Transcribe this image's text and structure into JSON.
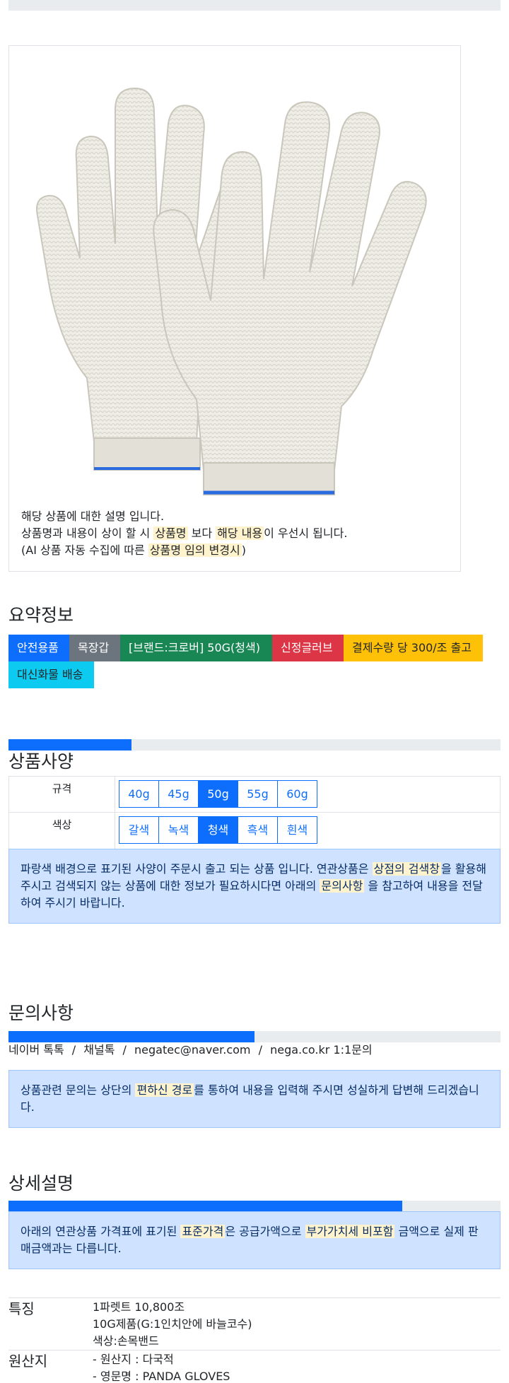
{
  "image": {
    "alt": "",
    "desc_line1": "해당 상품에 대한 설명 입니다.",
    "desc_line2_a": "상품명과 내용이 상이 할 시 ",
    "desc_line2_h1": "상품명",
    "desc_line2_b": " 보다 ",
    "desc_line2_h2": "해당 내용",
    "desc_line2_c": "이 우선시 됩니다.",
    "desc_line3_a": "(AI 상품 자동 수집에 따른 ",
    "desc_line3_h": "상품명 임의 변경시",
    "desc_line3_b": ")"
  },
  "summary": {
    "title": "요약정보",
    "badges": [
      {
        "label": "안전용품",
        "color": "#0d6efd"
      },
      {
        "label": "목장갑",
        "color": "#6c757d"
      },
      {
        "label": "[브랜드:크로버] 50G(청색)",
        "color": "#198754"
      },
      {
        "label": "신정글러브",
        "color": "#dc3545"
      },
      {
        "label": "결제수량 당 300/조 출고",
        "color": "#ffc107"
      },
      {
        "label": "대신화물 배송",
        "color": "#0dcaf0"
      }
    ]
  },
  "specs": {
    "title": "상품사양",
    "progress": 0.25,
    "rows": [
      {
        "label": "규격",
        "options": [
          "40g",
          "45g",
          "50g",
          "55g",
          "60g"
        ],
        "selected": "50g"
      },
      {
        "label": "색상",
        "options": [
          "갈색",
          "녹색",
          "청색",
          "흑색",
          "흰색"
        ],
        "selected": "청색"
      }
    ],
    "notice_a": "파랑색 배경으로 표기된 사양이 주문시 출고 되는 상품 입니다. 연관상품은 ",
    "notice_h1": "상점의 검색창",
    "notice_b": "을 활용해 주시고 검색되지 않는 상품에 대한 정보가 필요하시다면 아래의 ",
    "notice_h2": "문의사항",
    "notice_c": " 을 참고하여 내용을 전달하여 주시기 바랍니다."
  },
  "inquiry": {
    "title": "문의사항",
    "progress": 0.5,
    "channels": [
      "네이버 톡톡",
      "채널톡",
      "negatec@naver.com",
      "nega.co.kr 1:1문의"
    ],
    "separator": "/",
    "notice_a": "상품관련 문의는 상단의 ",
    "notice_h": "편하신 경로",
    "notice_b": "를 통하여 내용을 입력해 주시면 성실하게 답변해 드리겠습니다."
  },
  "details": {
    "title": "상세설명",
    "progress": 0.8,
    "notice_a": "아래의 연관상품 가격표에 표기된 ",
    "notice_h1": "표준가격",
    "notice_b": "은 공급가액으로 ",
    "notice_h2": "부가가치세 비포함",
    "notice_c": " 금액으로 실제 판매금액과는 다릅니다.",
    "rows": [
      {
        "label": "특징",
        "lines": [
          "1파렛트 10,800조",
          "10G제품(G:1인치안에 바늘코수)",
          "색상:손목밴드"
        ]
      },
      {
        "label": "원산지",
        "lines": [
          "- 원산지 : 다국적",
          "- 영문명 : PANDA GLOVES"
        ]
      }
    ]
  }
}
